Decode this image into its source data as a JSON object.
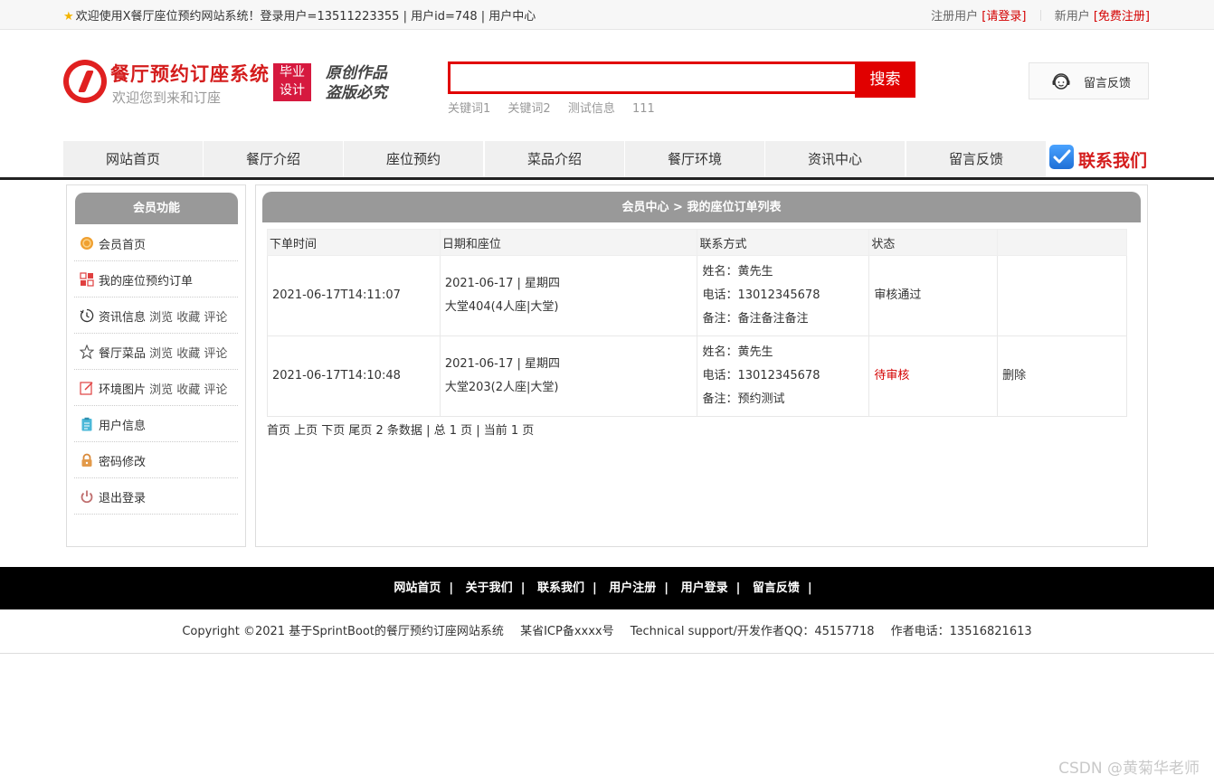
{
  "topbar": {
    "welcome": "欢迎使用X餐厅座位预约网站系统！登录用户=13511223355 | 用户id=748 | 用户中心",
    "register_user_label": "注册用户",
    "login_link": "[请登录]",
    "new_user_label": "新用户",
    "free_register_link": "[免费注册]"
  },
  "header": {
    "site_title": "餐厅预约订座系统",
    "site_subtitle": "欢迎您到来和订座",
    "badge_line1": "毕业",
    "badge_line2": "设计",
    "slogan_line1": "原创作品",
    "slogan_line2": "盗版必究",
    "search_value": "",
    "search_button": "搜索",
    "keywords": [
      "关键词1",
      "关键词2",
      "测试信息",
      "111"
    ],
    "feedback_label": "留言反馈"
  },
  "nav": {
    "items": [
      "网站首页",
      "餐厅介绍",
      "座位预约",
      "菜品介绍",
      "餐厅环境",
      "资讯中心",
      "留言反馈"
    ],
    "contact_label": "联系我们"
  },
  "sidebar": {
    "title": "会员功能",
    "items": [
      {
        "label": "会员首页",
        "sub": "",
        "icon": "coin-icon"
      },
      {
        "label": "我的座位预约订单",
        "sub": "",
        "icon": "grid-icon"
      },
      {
        "label": "资讯信息",
        "sub": " 浏览 收藏 评论",
        "icon": "clock-icon"
      },
      {
        "label": "餐厅菜品",
        "sub": " 浏览 收藏 评论",
        "icon": "star-icon"
      },
      {
        "label": "环境图片",
        "sub": " 浏览 收藏 评论",
        "icon": "edit-icon"
      },
      {
        "label": "用户信息",
        "sub": "",
        "icon": "clipboard-icon"
      },
      {
        "label": "密码修改",
        "sub": "",
        "icon": "lock-icon"
      },
      {
        "label": "退出登录",
        "sub": "",
        "icon": "power-icon"
      }
    ]
  },
  "main": {
    "title": "会员中心 > 我的座位订单列表",
    "columns": [
      "下单时间",
      "日期和座位",
      "联系方式",
      "状态",
      ""
    ],
    "rows": [
      {
        "order_time": "2021-06-17T14:11:07",
        "date": "2021-06-17 | 星期四",
        "seat": "大堂404(4人座|大堂)",
        "name": "姓名：黄先生",
        "phone": "电话：13012345678",
        "note": "备注：备注备注备注",
        "status": "审核通过",
        "action": ""
      },
      {
        "order_time": "2021-06-17T14:10:48",
        "date": "2021-06-17 | 星期四",
        "seat": "大堂203(2人座|大堂)",
        "name": "姓名：黄先生",
        "phone": "电话：13012345678",
        "note": "备注：预约测试",
        "status": "待审核",
        "action": "删除"
      }
    ],
    "pager": "首页 上页 下页 尾页 2 条数据 | 总 1 页 | 当前 1 页"
  },
  "footer": {
    "links": [
      "网站首页",
      "关于我们",
      "联系我们",
      "用户注册",
      "用户登录",
      "留言反馈"
    ],
    "copyright": "Copyright ©2021 基于SprintBoot的餐厅预约订座网站系统",
    "icp": "某省ICP备xxxx号",
    "support": "Technical support/开发作者QQ：45157718",
    "phone": "作者电话：13516821613"
  },
  "watermark": "CSDN @黄菊华老师",
  "colors": {
    "brand_red": "#d41c1c",
    "search_red": "#e10000",
    "header_gray": "#999999",
    "pending_status": "#d40000"
  }
}
